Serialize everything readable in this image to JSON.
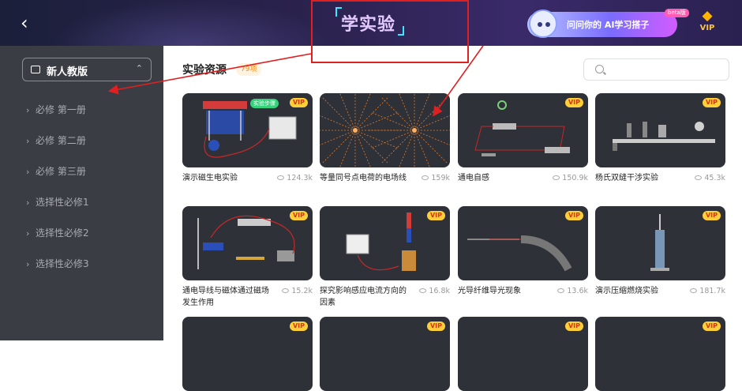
{
  "header": {
    "back_icon": "chevron-left-icon",
    "title": "学实验"
  },
  "ai_banner": {
    "text": "问问你的 AI学习搭子",
    "beta": "beta版"
  },
  "vip_top": {
    "icon": "diamond-icon",
    "label": "VIP"
  },
  "sidebar": {
    "edition_label": "新人教版",
    "items": [
      {
        "label": "必修 第一册"
      },
      {
        "label": "必修 第二册"
      },
      {
        "label": "必修 第三册"
      },
      {
        "label": "选择性必修1"
      },
      {
        "label": "选择性必修2"
      },
      {
        "label": "选择性必修3"
      }
    ]
  },
  "main": {
    "section_title": "实验资源",
    "count": "79项",
    "search_placeholder": "",
    "vip_badge": "VIP",
    "step_badge": "实验步骤",
    "cards": [
      {
        "title": "演示磁生电实验",
        "views": "124.3k"
      },
      {
        "title": "等量同号点电荷的电场线",
        "views": "159k"
      },
      {
        "title": "通电自感",
        "views": "150.9k"
      },
      {
        "title": "杨氏双缝干涉实验",
        "views": "45.3k"
      },
      {
        "title": "通电导线与磁体通过磁场发生作用",
        "views": "15.2k"
      },
      {
        "title": "探究影响感应电流方向的因素",
        "views": "16.8k"
      },
      {
        "title": "光导纤维导光现象",
        "views": "13.6k"
      },
      {
        "title": "演示压缩燃烧实验",
        "views": "181.7k"
      },
      {
        "title": "",
        "views": ""
      },
      {
        "title": "",
        "views": ""
      },
      {
        "title": "",
        "views": ""
      },
      {
        "title": "",
        "views": ""
      }
    ]
  },
  "colors": {
    "accent": "#f08c1a",
    "annotation": "#e02020",
    "sidebar_bg": "#3a3d44",
    "card_bg": "#2e3138"
  }
}
